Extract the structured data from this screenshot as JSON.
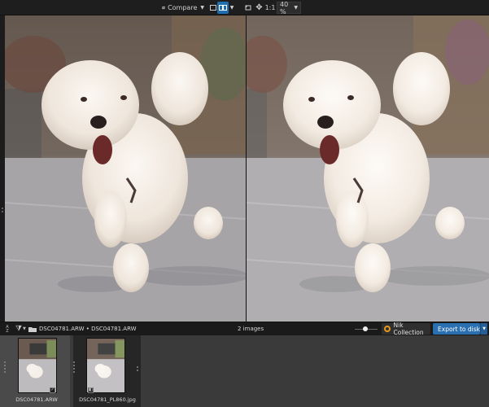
{
  "toolbar": {
    "compare_label": "Compare",
    "zoom_1to1": "1:1",
    "zoom_percent": "40 %"
  },
  "filmstrip_bar": {
    "sort_top": "A",
    "sort_bottom": "Z",
    "path": "DSC04781.ARW • DSC04781.ARW",
    "count": "2 images",
    "nik_label": "Nik Collection",
    "export_label": "Export to disk"
  },
  "filmstrip": {
    "items": [
      {
        "label": "DSC04781.ARW"
      },
      {
        "label": "DSC04781_PL860.jpg"
      }
    ]
  },
  "colors": {
    "accent": "#2a6fb0",
    "nik_ring": "#e89a1d"
  }
}
